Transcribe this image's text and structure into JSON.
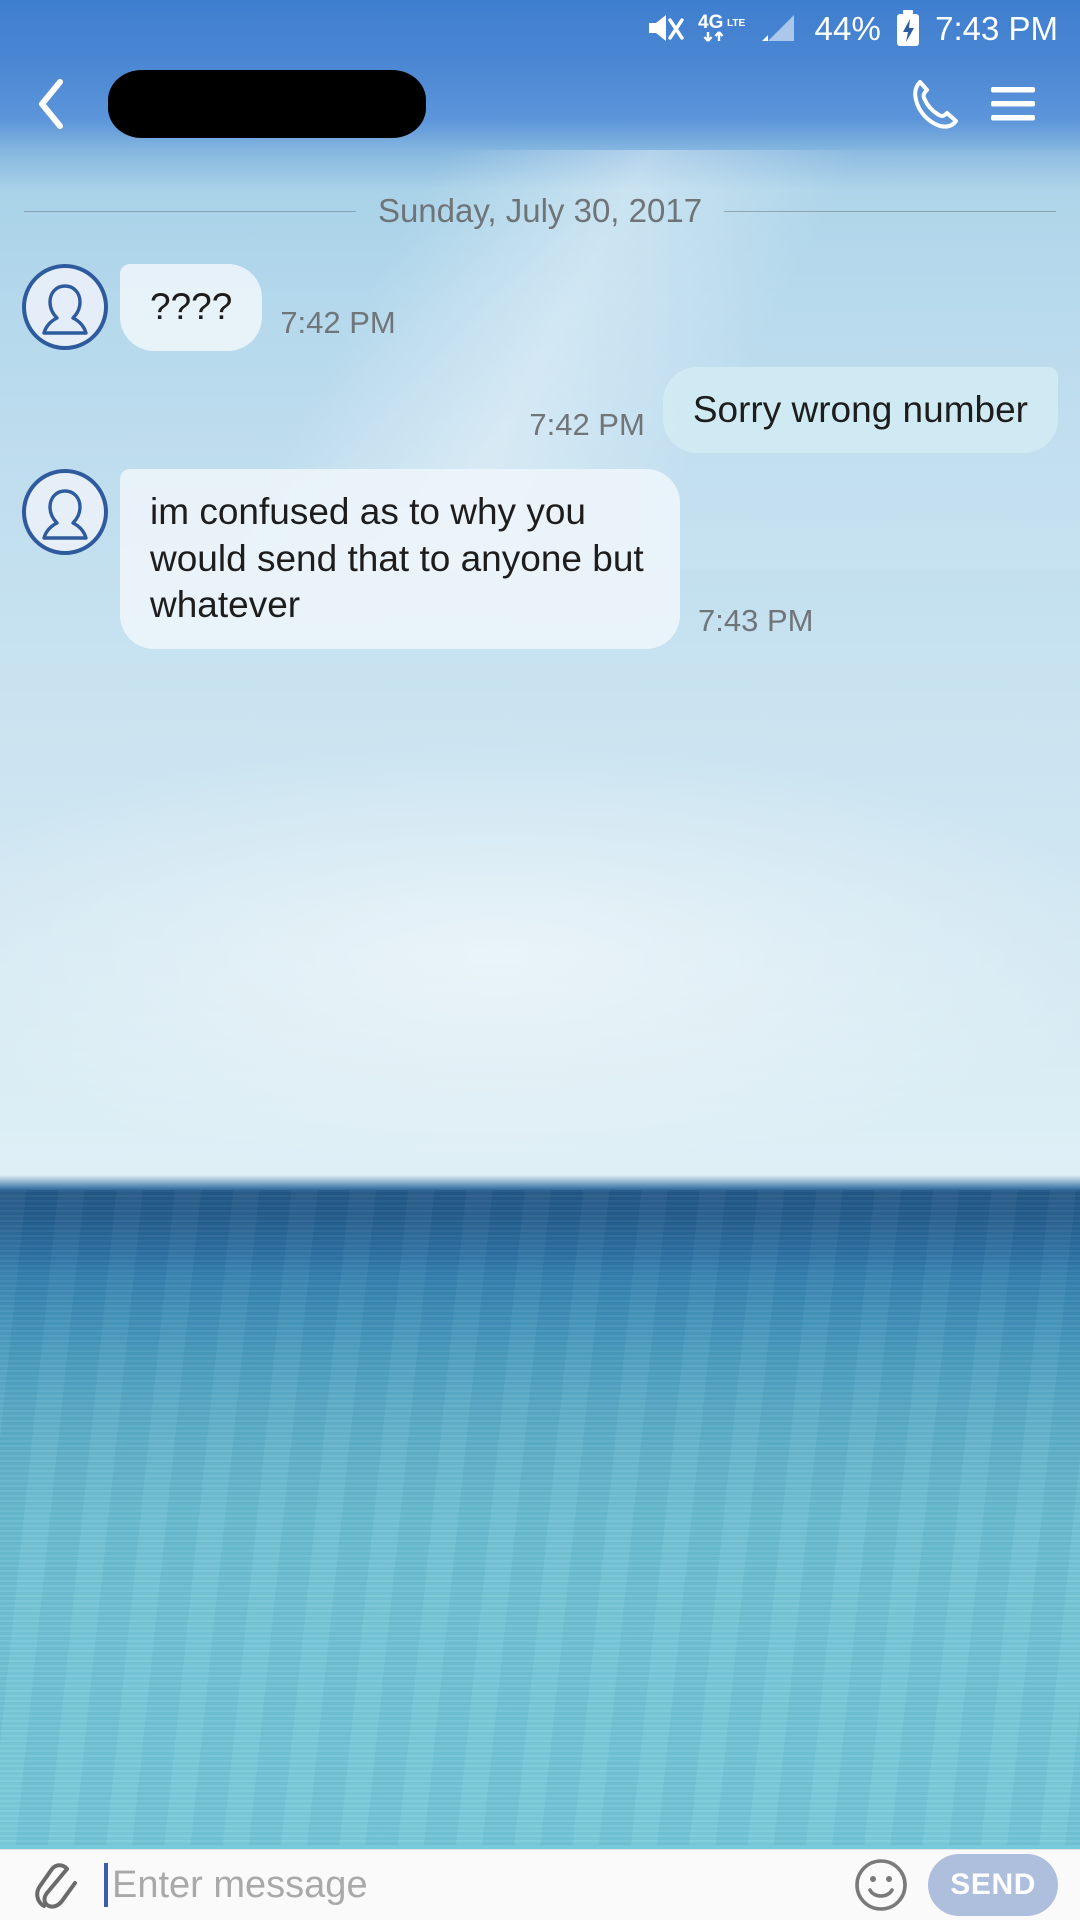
{
  "status_bar": {
    "mute_icon": "mute-bell-icon",
    "network_label": "4G",
    "network_sub": "LTE",
    "signal_icon": "signal-bars-icon",
    "battery_percent": "44%",
    "battery_icon": "battery-charging-icon",
    "time": "7:43 PM"
  },
  "app_bar": {
    "back_icon": "back-chevron-icon",
    "title": "",
    "title_redacted": true,
    "call_icon": "phone-icon",
    "menu_icon": "hamburger-menu-icon"
  },
  "conversation": {
    "date_divider": "Sunday, July 30, 2017",
    "messages": [
      {
        "direction": "in",
        "text": "????",
        "time": "7:42 PM",
        "avatar_icon": "person-avatar-icon"
      },
      {
        "direction": "out",
        "text": "Sorry wrong number",
        "time": "7:42 PM"
      },
      {
        "direction": "in",
        "text": "im confused as to why you would send that to anyone but whatever",
        "time": "7:43 PM",
        "avatar_icon": "person-avatar-icon"
      }
    ]
  },
  "input_bar": {
    "attach_icon": "paperclip-icon",
    "message_value": "",
    "placeholder": "Enter message",
    "emoji_icon": "smiley-face-icon",
    "send_label": "SEND"
  },
  "colors": {
    "app_bar": "#4a86d2",
    "send_button": "#aebedd",
    "avatar_outline": "#2e5a9e",
    "bubble_in": "#eef5fa",
    "bubble_out": "#d1ebf3",
    "timestamp": "#70757a"
  }
}
